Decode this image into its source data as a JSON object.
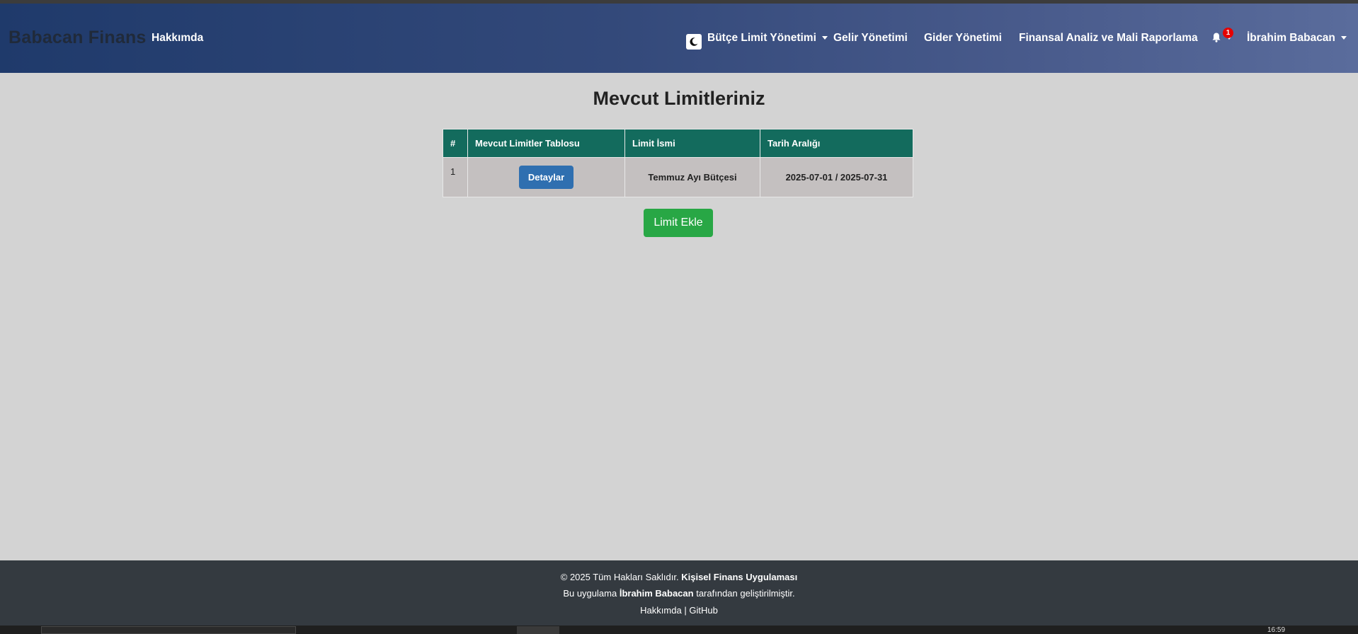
{
  "navbar": {
    "brand": "Babacan Finans",
    "about": "Hakkımda",
    "budget_limit": "Bütçe Limit Yönetimi",
    "income": "Gelir Yönetimi",
    "expense": "Gider Yönetimi",
    "analysis": "Finansal Analiz ve Mali Raporlama",
    "notification_count": "1",
    "user": "İbrahim Babacan",
    "theme_icon": "moon-icon",
    "bell_icon": "bell-icon"
  },
  "main": {
    "title": "Mevcut Limitleriniz",
    "table": {
      "headers": [
        "#",
        "Mevcut Limitler Tablosu",
        "Limit İsmi",
        "Tarih Aralığı"
      ],
      "rows": [
        {
          "num": "1",
          "action": "Detaylar",
          "name": "Temmuz Ayı Bütçesi",
          "range": "2025-07-01 / 2025-07-31"
        }
      ]
    },
    "add_button": "Limit Ekle"
  },
  "footer": {
    "copyright": "© 2025 Tüm Hakları Saklıdır.",
    "app_name": "Kişisel Finans Uygulaması",
    "built_prefix": "Bu uygulama",
    "author": "İbrahim Babacan",
    "built_suffix": "tarafından geliştirilmiştir.",
    "about_link": "Hakkımda",
    "separator": "|",
    "github_link": "GitHub"
  },
  "taskbar": {
    "clock": "16:59"
  },
  "colors": {
    "accent_header": "#136b5d",
    "add_button": "#28a745",
    "detail_button": "#2f6fb0",
    "badge": "#e60000"
  }
}
